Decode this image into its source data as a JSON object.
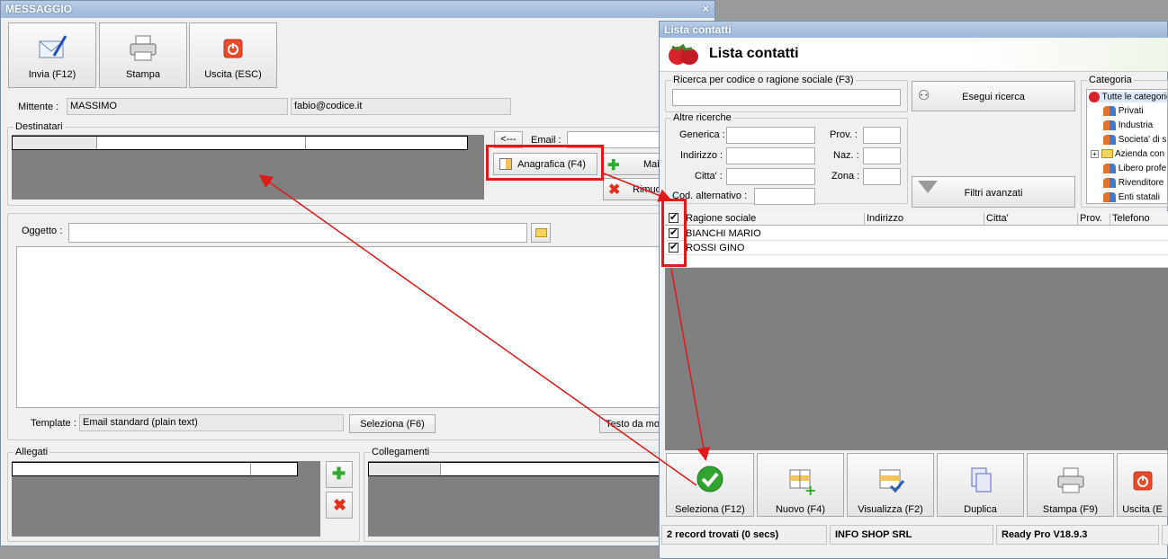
{
  "main_window": {
    "title": "MESSAGGIO",
    "close": "×",
    "toolbar": {
      "send_label": "Invia (F12)",
      "print_label": "Stampa",
      "exit_label": "Uscita (ESC)"
    },
    "sender_label": "Mittente :",
    "sender_name": "MASSIMO",
    "sender_email": "fabio@codice.it",
    "recipients_title": "Destinatari",
    "arrow_button": "<---",
    "email_label": "Email :",
    "anagrafica_button": "Anagrafica (F4)",
    "mail_button": "Mai",
    "remove_button": "Rimuo",
    "subject_label": "Oggetto :",
    "template_label": "Template :",
    "template_value": "Email standard (plain text)",
    "select_button": "Seleziona (F6)",
    "text_button": "Testo da mo",
    "attachments_title": "Allegati",
    "links_title": "Collegamenti"
  },
  "contacts_window": {
    "title": "Lista contatti",
    "heading": "Lista contatti",
    "search_group": "Ricerca per codice o ragione sociale (F3)",
    "search_value": "",
    "search_button": "Esegui ricerca",
    "other_group": "Altre ricerche",
    "filters": {
      "generica": "Generica :",
      "indirizzo": "Indirizzo :",
      "citta": "Citta' :",
      "cod_alt": "Cod. alternativo :",
      "prov": "Prov. :",
      "naz": "Naz. :",
      "zona": "Zona :"
    },
    "advanced_filters_button": "Filtri avanzati",
    "category_group": "Categoria",
    "categories": [
      {
        "label": "Tutte le categorie",
        "icon": "strawberry-icon"
      },
      {
        "label": "Privati",
        "icon": "people-icon"
      },
      {
        "label": "Industria",
        "icon": "people-icon"
      },
      {
        "label": "Societa' di s",
        "icon": "people-icon"
      },
      {
        "label": "Azienda con",
        "icon": "folder-icon"
      },
      {
        "label": "Libero profe",
        "icon": "people-icon"
      },
      {
        "label": "Rivenditore",
        "icon": "people-icon"
      },
      {
        "label": "Enti statali",
        "icon": "people-icon"
      }
    ],
    "table": {
      "columns": [
        "Ragione sociale",
        "Indirizzo",
        "Citta'",
        "Prov.",
        "Telefono"
      ],
      "rows": [
        {
          "checked": true,
          "ragione_sociale": "BIANCHI MARIO"
        },
        {
          "checked": true,
          "ragione_sociale": "ROSSI GINO"
        }
      ]
    },
    "actions": {
      "select": "Seleziona (F12)",
      "new": "Nuovo (F4)",
      "view": "Visualizza (F2)",
      "duplicate": "Duplica",
      "print": "Stampa (F9)",
      "exit": "Uscita (E"
    },
    "status": {
      "records": "2 record trovati (0 secs)",
      "company": "INFO SHOP SRL",
      "version": "Ready Pro V18.9.3"
    }
  },
  "colors": {
    "annotation": "#e0191b",
    "title_bar": "#9db7d8",
    "grid_bg": "#808080"
  }
}
